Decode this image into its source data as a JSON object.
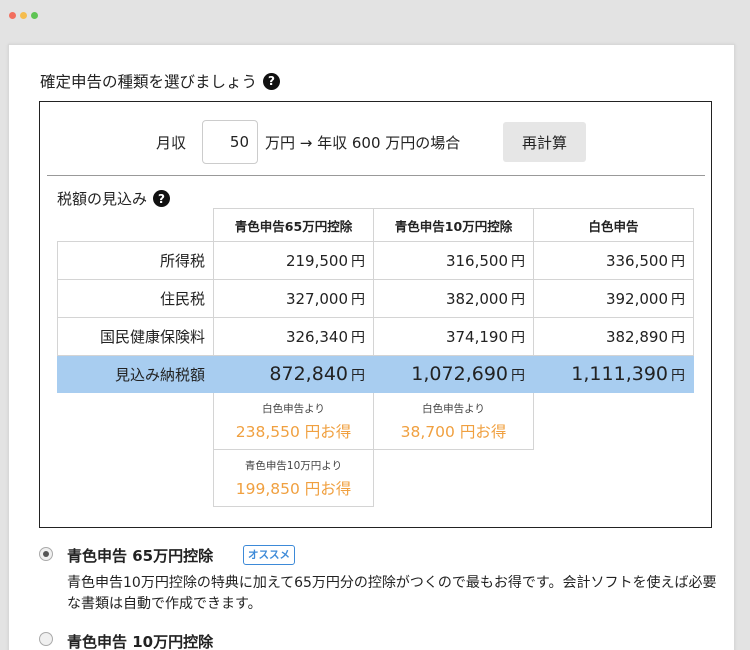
{
  "window": {
    "dots": {
      "close": "#f26f5f",
      "minimize": "#f5bd4f",
      "maximize": "#5fc454"
    }
  },
  "section": {
    "title": "確定申告の種類を選びましょう",
    "help_icon_glyph": "?"
  },
  "calculator": {
    "monthly_label": "月収",
    "monthly_value": "50",
    "annual_text": "万円 → 年収 600 万円の場合",
    "recalc_label": "再計算"
  },
  "estimate": {
    "title": "税額の見込み",
    "help_icon_glyph": "?",
    "columns": [
      "青色申告65万円控除",
      "青色申告10万円控除",
      "白色申告"
    ],
    "unit": "円",
    "rows": [
      {
        "label": "所得税",
        "values": [
          "219,500",
          "316,500",
          "336,500"
        ]
      },
      {
        "label": "住民税",
        "values": [
          "327,000",
          "382,000",
          "392,000"
        ]
      },
      {
        "label": "国民健康保険料",
        "values": [
          "326,340",
          "374,190",
          "382,890"
        ]
      }
    ],
    "total": {
      "label": "見込み納税額",
      "values": [
        "872,840",
        "1,072,690",
        "1,111,390"
      ]
    },
    "savings": [
      {
        "from": "白色申告より",
        "amount": "238,550 円お得"
      },
      {
        "from": "白色申告より",
        "amount": "38,700 円お得"
      },
      {
        "from": "青色申告10万円より",
        "amount": "199,850 円お得"
      }
    ]
  },
  "options": [
    {
      "title": "青色申告 65万円控除",
      "badge": "オススメ",
      "selected": true,
      "description": "青色申告10万円控除の特典に加えて65万円分の控除がつくので最もお得です。会計ソフトを使えば必要な書類は自動で作成できます。"
    },
    {
      "title": "青色申告 10万円控除",
      "selected": false
    }
  ],
  "colors": {
    "accent_blue": "#3d8ad8",
    "total_row_bg": "#a8cdf0",
    "savings_orange": "#f0a040"
  }
}
